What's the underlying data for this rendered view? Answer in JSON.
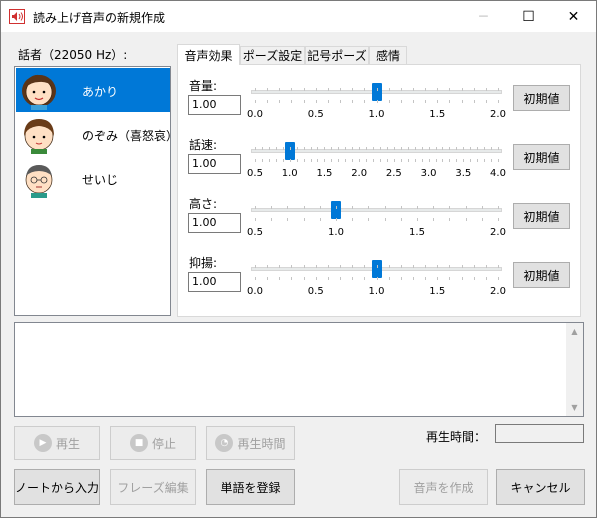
{
  "window": {
    "title": "読み上げ音声の新規作成",
    "minimize_glyph": "─",
    "maximize_glyph": "☐",
    "close_glyph": "✕"
  },
  "speakers": {
    "label": "話者（22050 Hz）:",
    "items": [
      {
        "name": "あかり",
        "selected": true
      },
      {
        "name": "のぞみ（喜怒哀）",
        "selected": false
      },
      {
        "name": "せいじ",
        "selected": false
      }
    ]
  },
  "tabs": [
    {
      "label": "音声効果",
      "active": true
    },
    {
      "label": "ポーズ設定",
      "active": false
    },
    {
      "label": "記号ポーズ",
      "active": false
    },
    {
      "label": "感情",
      "active": false
    }
  ],
  "params": [
    {
      "label": "音量:",
      "value": "1.00",
      "min": 0.0,
      "max": 2.0,
      "current": 1.0,
      "ticks": [
        "0.0",
        "0.5",
        "1.0",
        "1.5",
        "2.0"
      ],
      "reset_label": "初期値"
    },
    {
      "label": "話速:",
      "value": "1.00",
      "min": 0.5,
      "max": 4.0,
      "current": 1.0,
      "ticks": [
        "0.5",
        "1.0",
        "1.5",
        "2.0",
        "2.5",
        "3.0",
        "3.5",
        "4.0"
      ],
      "reset_label": "初期値"
    },
    {
      "label": "高さ:",
      "value": "1.00",
      "min": 0.5,
      "max": 2.0,
      "current": 1.0,
      "ticks": [
        "0.5",
        "1.0",
        "1.5",
        "2.0"
      ],
      "reset_label": "初期値"
    },
    {
      "label": "抑揚:",
      "value": "1.00",
      "min": 0.0,
      "max": 2.0,
      "current": 1.0,
      "ticks": [
        "0.0",
        "0.5",
        "1.0",
        "1.5",
        "2.0"
      ],
      "reset_label": "初期値"
    }
  ],
  "text_area": {
    "value": ""
  },
  "playback": {
    "play_label": "再生",
    "stop_label": "停止",
    "play_time_button_label": "再生時間",
    "play_time_label": "再生時間：",
    "play_time_value": ""
  },
  "footer": {
    "note_input_label": "ノートから入力",
    "phrase_edit_label": "フレーズ編集",
    "register_word_label": "単語を登録",
    "create_audio_label": "音声を作成",
    "cancel_label": "キャンセル"
  },
  "colors": {
    "accent": "#0078d7",
    "icon_red": "#d03030"
  },
  "icons": {
    "app": "speaker-icon",
    "play": "play-icon",
    "stop": "stop-icon",
    "timer": "timer-icon"
  }
}
